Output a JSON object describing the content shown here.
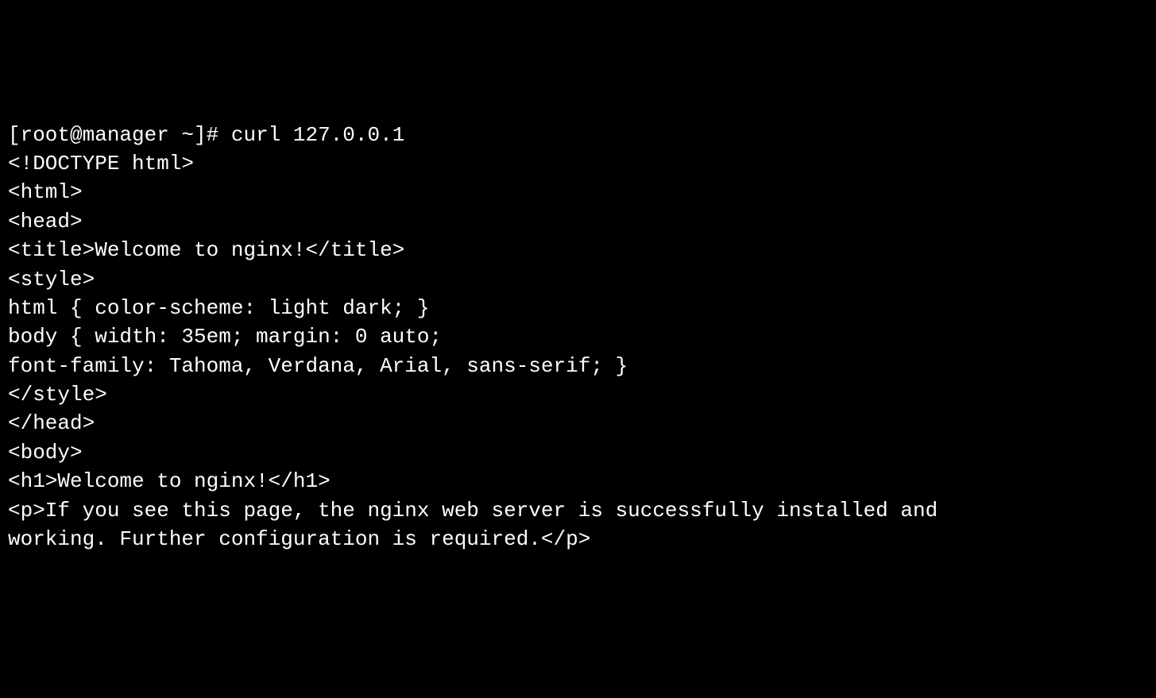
{
  "terminal": {
    "prompt": "[root@manager ~]# ",
    "command": "curl 127.0.0.1",
    "output_lines": [
      "<!DOCTYPE html>",
      "<html>",
      "<head>",
      "<title>Welcome to nginx!</title>",
      "<style>",
      "html { color-scheme: light dark; }",
      "body { width: 35em; margin: 0 auto;",
      "font-family: Tahoma, Verdana, Arial, sans-serif; }",
      "</style>",
      "</head>",
      "<body>",
      "<h1>Welcome to nginx!</h1>",
      "<p>If you see this page, the nginx web server is successfully installed and",
      "working. Further configuration is required.</p>"
    ]
  }
}
